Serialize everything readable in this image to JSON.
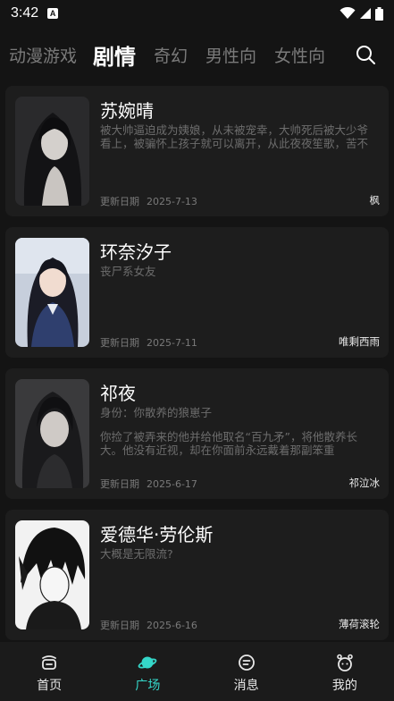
{
  "status_bar": {
    "time": "3:42",
    "app_glyph": "A"
  },
  "tabs": [
    {
      "label": "动漫游戏",
      "active": false
    },
    {
      "label": "剧情",
      "active": true
    },
    {
      "label": "奇幻",
      "active": false
    },
    {
      "label": "男性向",
      "active": false
    },
    {
      "label": "女性向",
      "active": false
    }
  ],
  "search_icon": "search-icon",
  "date_label": "更新日期",
  "cards": [
    {
      "name": "苏婉晴",
      "tag": "",
      "body": "被大帅逼迫成为姨娘，从未被宠幸，大帅死后被大少爷看上，被骗怀上孩子就可以离开，从此夜夜笙歌，苦不堪言",
      "date": "2025-7-13",
      "author": "枫"
    },
    {
      "name": "环奈汐子",
      "tag": "",
      "body": "丧尸系女友",
      "date": "2025-7-11",
      "author": "唯剩西雨"
    },
    {
      "name": "祁夜",
      "tag": "身份：你散养的狼崽子",
      "body": "你捡了被弄来的他并给他取名“百九矛”，将他散养长大。他没有近视，却在你面前永远戴着那副笨重",
      "date": "2025-6-17",
      "author": "祁泣冰"
    },
    {
      "name": "爱德华·劳伦斯",
      "tag": "",
      "body": "大概是无限流?",
      "date": "2025-6-16",
      "author": "薄荷滚轮"
    }
  ],
  "bottom_nav": [
    {
      "label": "首页",
      "icon": "home-icon",
      "active": false
    },
    {
      "label": "广场",
      "icon": "planet-icon",
      "active": true
    },
    {
      "label": "消息",
      "icon": "message-icon",
      "active": false
    },
    {
      "label": "我的",
      "icon": "profile-icon",
      "active": false
    }
  ],
  "colors": {
    "accent": "#35d7c9",
    "background": "#141414",
    "card": "#1d1d1d"
  }
}
